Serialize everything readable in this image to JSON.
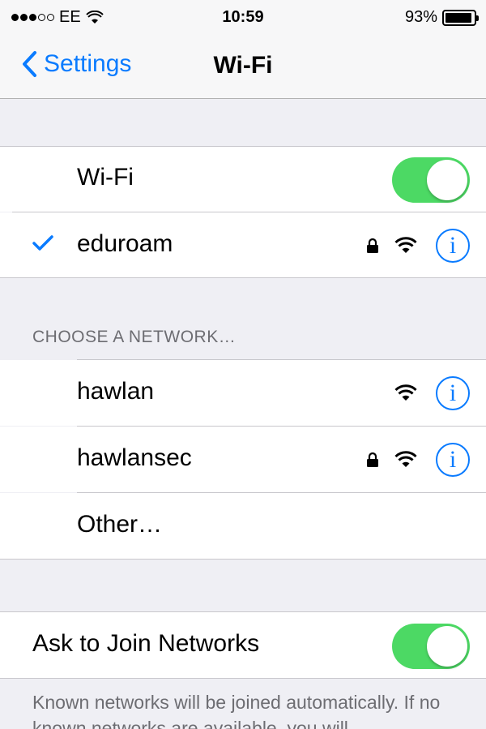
{
  "status_bar": {
    "carrier": "EE",
    "time": "10:59",
    "battery": "93%",
    "battery_level": 0.93,
    "signal_bars_filled": 3,
    "signal_bars_total": 5
  },
  "nav": {
    "back_label": "Settings",
    "title": "Wi-Fi"
  },
  "wifi_toggle": {
    "label": "Wi-Fi",
    "on": true
  },
  "connected_network": {
    "name": "eduroam",
    "secured": true
  },
  "section_header": "CHOOSE A NETWORK…",
  "networks": [
    {
      "name": "hawlan",
      "secured": false
    },
    {
      "name": "hawlansec",
      "secured": true
    }
  ],
  "other_label": "Other…",
  "ask_to_join": {
    "label": "Ask to Join Networks",
    "on": true
  },
  "footer": "Known networks will be joined automatically. If no known networks are available, you will",
  "colors": {
    "accent": "#0a7bff",
    "toggle_on": "#4cd964",
    "background": "#efeff4"
  }
}
